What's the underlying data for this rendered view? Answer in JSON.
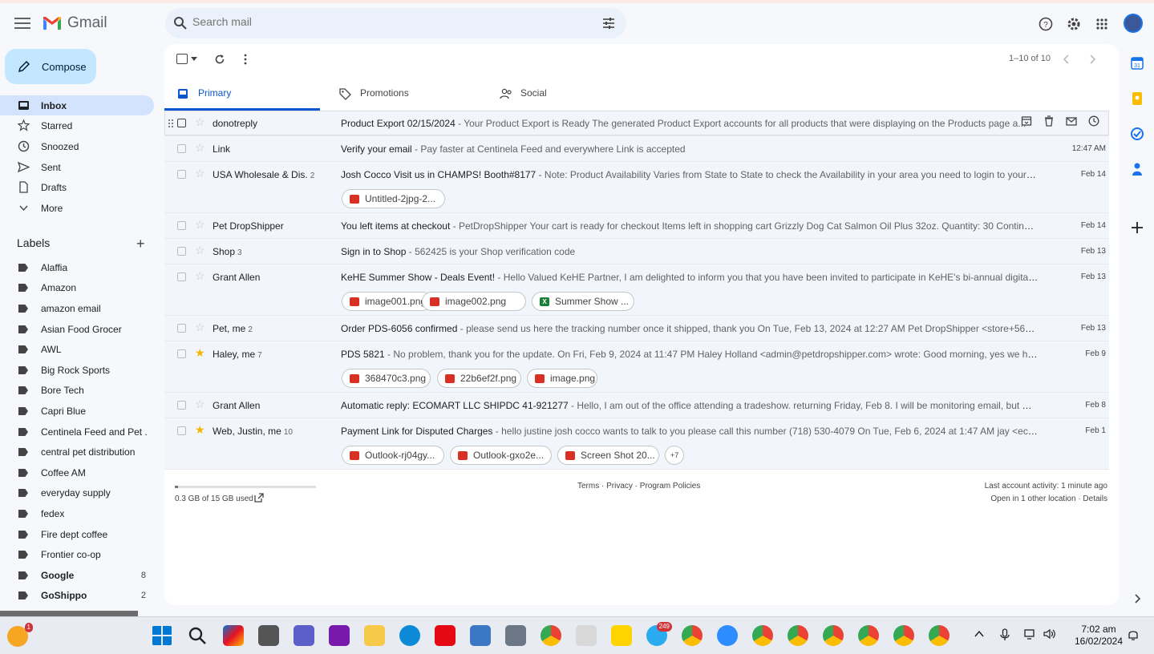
{
  "app": {
    "brand": "Gmail"
  },
  "search": {
    "placeholder": "Search mail"
  },
  "compose": {
    "label": "Compose"
  },
  "nav": [
    {
      "label": "Inbox",
      "icon": "inbox-icon",
      "active": true
    },
    {
      "label": "Starred",
      "icon": "star-icon"
    },
    {
      "label": "Snoozed",
      "icon": "clock-icon"
    },
    {
      "label": "Sent",
      "icon": "send-icon"
    },
    {
      "label": "Drafts",
      "icon": "draft-icon"
    },
    {
      "label": "More",
      "icon": "chevron-down-icon"
    }
  ],
  "labels": {
    "title": "Labels",
    "add": "+",
    "items": [
      {
        "label": "Alaffia"
      },
      {
        "label": "Amazon"
      },
      {
        "label": "amazon email"
      },
      {
        "label": "Asian Food Grocer"
      },
      {
        "label": "AWL"
      },
      {
        "label": "Big Rock Sports"
      },
      {
        "label": "Bore Tech"
      },
      {
        "label": "Capri Blue"
      },
      {
        "label": "Centinela Feed and Pet ..."
      },
      {
        "label": "central pet distribution"
      },
      {
        "label": "Coffee AM"
      },
      {
        "label": "everyday supply"
      },
      {
        "label": "fedex"
      },
      {
        "label": "Fire dept coffee"
      },
      {
        "label": "Frontier co-op"
      },
      {
        "label": "Google",
        "count": "8",
        "bold": true
      },
      {
        "label": "GoShippo",
        "count": "2",
        "bold": true
      }
    ]
  },
  "toolbar": {
    "pagination": "1–10 of 10"
  },
  "tabs": [
    {
      "label": "Primary",
      "active": true
    },
    {
      "label": "Promotions"
    },
    {
      "label": "Social"
    }
  ],
  "emails": [
    {
      "from": "donotreply",
      "count": "",
      "subject": "Product Export 02/15/2024",
      "snippet": " - Your Product Export is Ready The generated Product Export accounts for all products that were displaying on the Products page a...",
      "date": "",
      "starred": false,
      "hover": true,
      "attachments": []
    },
    {
      "from": "Link",
      "count": "",
      "subject": "Verify your email",
      "snippet": " - Pay faster at Centinela Feed and everywhere Link is accepted",
      "date": "12:47 AM",
      "starred": false,
      "attachments": []
    },
    {
      "from": "USA Wholesale & Dis.",
      "count": "2",
      "subject": "Josh Cocco Visit us in CHAMPS! Booth#8177",
      "snippet": " - Note: Product Availability Varies from State to State to check the Availability in your area you need to login to your account ...",
      "date": "Feb 14",
      "starred": false,
      "attachments": [
        {
          "name": "Untitled-2jpg-2...",
          "kind": "img"
        }
      ]
    },
    {
      "from": "Pet DropShipper",
      "count": "",
      "subject": "You left items at checkout",
      "snippet": " - PetDropShipper Your cart is ready for checkout Items left in shopping cart Grizzly Dog Cat Salmon Oil Plus 32oz. Quantity: 30 Continue check...",
      "date": "Feb 14",
      "starred": false,
      "attachments": []
    },
    {
      "from": "Shop",
      "count": "3",
      "subject": "Sign in to Shop",
      "snippet": " - 562425 is your Shop verification code",
      "date": "Feb 13",
      "starred": false,
      "attachments": []
    },
    {
      "from": "Grant Allen",
      "count": "",
      "subject": "KeHE Summer Show - Deals Event!",
      "snippet": " - Hello Valued KeHE Partner, I am delighted to inform you that you have been invited to participate in KeHE's bi-annual digital buying s...",
      "date": "Feb 13",
      "starred": false,
      "attachments": [
        {
          "name": "image001.png",
          "kind": "img"
        },
        {
          "name": "image002.png",
          "kind": "img"
        },
        {
          "name": "Summer Show ...",
          "kind": "xls"
        }
      ]
    },
    {
      "from": "Pet, me",
      "count": "2",
      "subject": "Order PDS-6056 confirmed",
      "snippet": " - please send us here the tracking number once it shipped, thank you On Tue, Feb 13, 2024 at 12:27 AM Pet DropShipper <store+56161206467...",
      "date": "Feb 13",
      "starred": false,
      "attachments": []
    },
    {
      "from": "Haley, me",
      "count": "7",
      "subject": "PDS 5821",
      "snippet": " - No problem, thank you for the update. On Fri, Feb 9, 2024 at 11:47 PM Haley Holland <admin@petdropshipper.com> wrote: Good morning, yes we have an upda...",
      "date": "Feb 9",
      "starred": true,
      "attachments": [
        {
          "name": "368470c3.png",
          "kind": "img"
        },
        {
          "name": "22b6ef2f.png",
          "kind": "img"
        },
        {
          "name": "image.png",
          "kind": "img"
        }
      ]
    },
    {
      "from": "Grant Allen",
      "count": "",
      "subject": "Automatic reply: ECOMART LLC SHIPDC 41-921277",
      "snippet": " - Hello, I am out of the office attending a tradeshow. returning Friday, Feb 8. I will be monitoring email, but my response...",
      "date": "Feb 8",
      "starred": false,
      "attachments": []
    },
    {
      "from": "Web, Justin, me",
      "count": "10",
      "subject": "Payment Link for Disputed Charges",
      "snippet": " - hello justine josh cocco wants to talk to you please call this number (718) 530-4079 On Tue, Feb 6, 2024 at 1:47 AM jay <ecomartgoo...",
      "date": "Feb 1",
      "starred": true,
      "attachments": [
        {
          "name": "Outlook-rj04gy...",
          "kind": "img"
        },
        {
          "name": "Outlook-gxo2e...",
          "kind": "img"
        },
        {
          "name": "Screen Shot 20...",
          "kind": "img"
        }
      ],
      "more": "+7"
    }
  ],
  "footer": {
    "storage": "0.3 GB of 15 GB used",
    "storage_fraction": 0.02,
    "terms": "Terms · Privacy · Program Policies",
    "activity": "Last account activity: 1 minute ago",
    "location": "Open in 1 other location · Details"
  },
  "taskbar": {
    "telegram_badge": "249",
    "notif_badge": "1",
    "time": "7:02 am",
    "date": "16/02/2024"
  },
  "colors": {
    "accent": "#0b57d0",
    "compose_bg": "#c2e7ff",
    "active_nav": "#d3e3fd"
  }
}
